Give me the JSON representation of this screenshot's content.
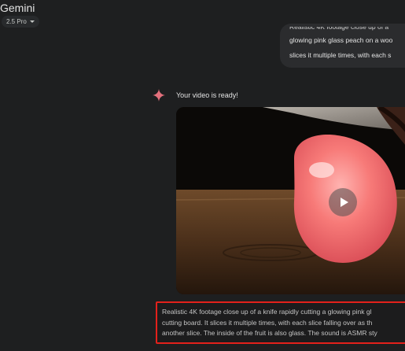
{
  "app": {
    "title": "Gemini"
  },
  "model_selector": {
    "label": "2.5 Pro",
    "icon": "chevron-down-icon"
  },
  "user_message": {
    "lines": [
      "Realistic 4K footage close up of a",
      "glowing pink glass peach on a woo",
      "slices it multiple times, with each s"
    ]
  },
  "assistant_message": {
    "icon": "gemini-spark-icon",
    "status_text": "Your video is ready!",
    "spark_color": "#e3707c"
  },
  "video": {
    "play_icon": "play-icon"
  },
  "prompt_caption": {
    "lines": [
      "Realistic 4K footage close up of a knife rapidly cutting a glowing pink gl",
      "cutting board. It slices it multiple times, with each slice falling over as th",
      "another slice. The inside of the fruit is also glass. The sound is ASMR sty"
    ],
    "highlight_color": "#e3211b"
  }
}
